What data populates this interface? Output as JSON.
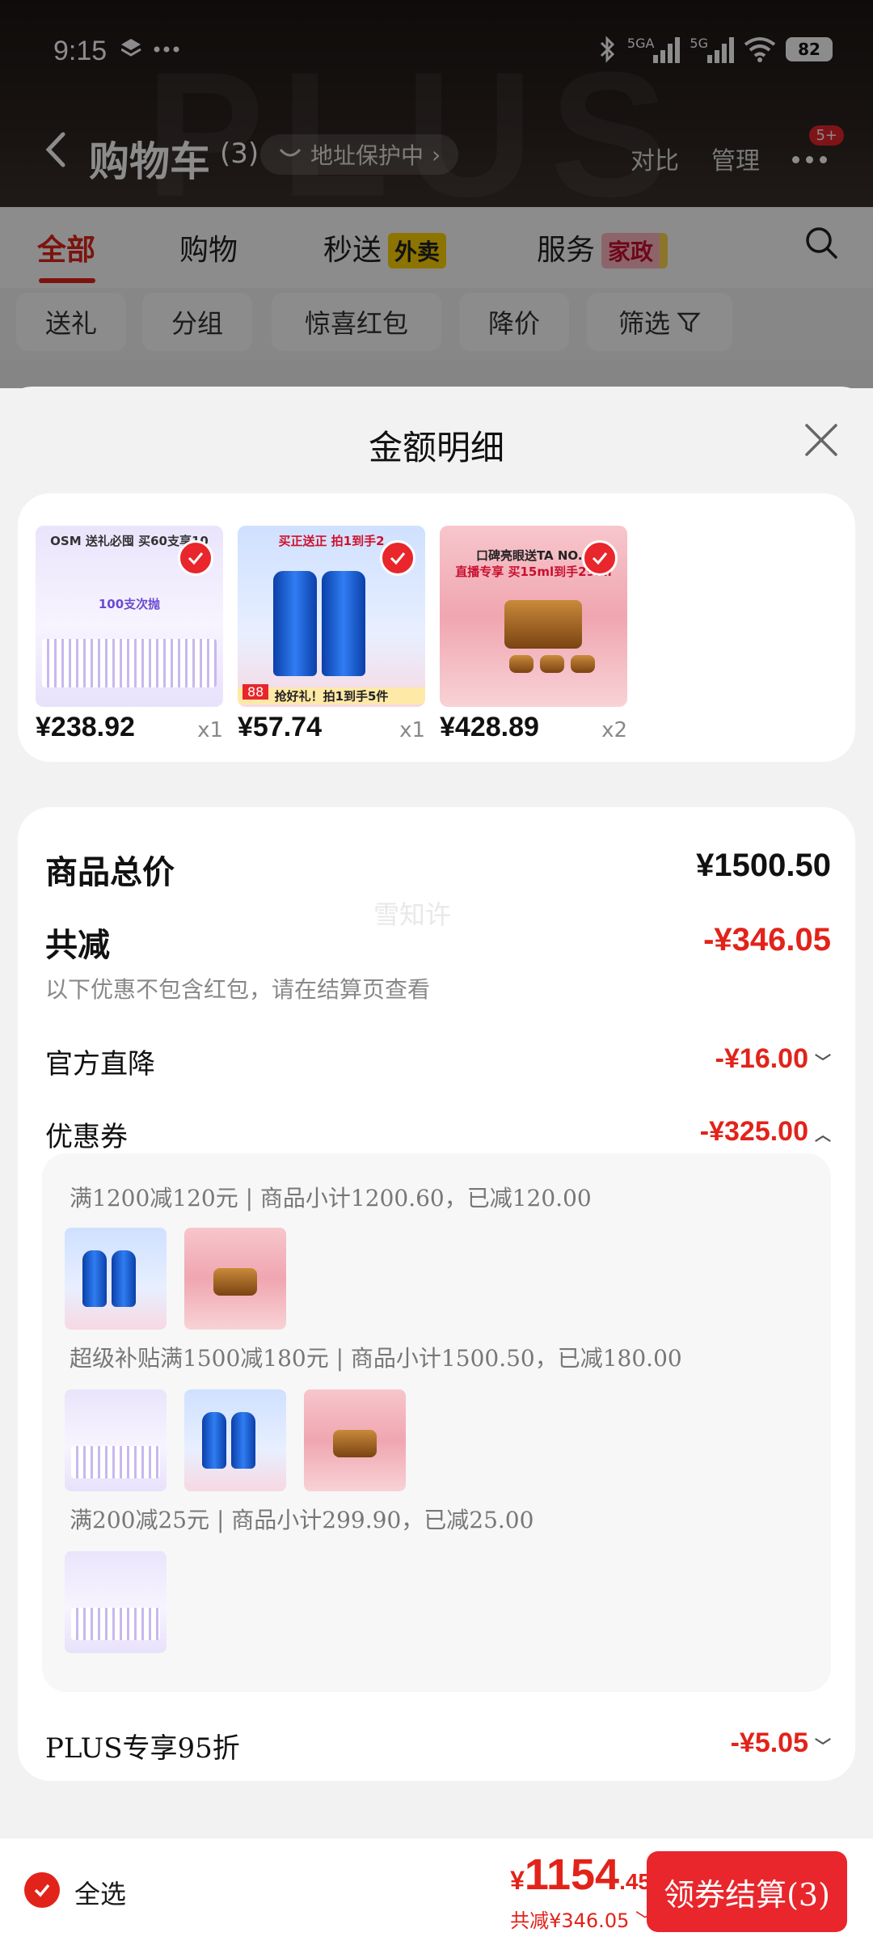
{
  "status_bar": {
    "time": "9:15",
    "battery": "82",
    "signal1_label": "5GA",
    "signal2_label": "5G"
  },
  "nav": {
    "title": "购物车",
    "count": "(3)",
    "address_pill": "地址保护中",
    "compare": "对比",
    "manage": "管理",
    "badge": "5+",
    "watermark": "PLUS"
  },
  "tabs": [
    {
      "label": "全部"
    },
    {
      "label": "购物"
    },
    {
      "label": "秒送",
      "tag": "外卖"
    },
    {
      "label": "服务",
      "tag": "家政"
    }
  ],
  "chips": [
    "送礼",
    "分组",
    "惊喜红包",
    "降价",
    "筛选"
  ],
  "sheet": {
    "title": "金额明细",
    "products": [
      {
        "price": "¥238.92",
        "qty": "x1",
        "img_text1": "OSM 送礼必囤 买60支享10",
        "img_text2": "100支次抛"
      },
      {
        "price": "¥57.74",
        "qty": "x1",
        "img_text1": "买正送正 拍1到手2",
        "img_text2": "抢好礼！拍1到手5件",
        "img_tag": "88"
      },
      {
        "price": "¥428.89",
        "qty": "x2",
        "img_text1": "口碑亮眼送TA NO.1",
        "img_text2": "直播专享 买15ml到手29ml"
      }
    ],
    "summary": {
      "goods_total_label": "商品总价",
      "goods_total_value": "¥1500.50",
      "total_discount_label": "共减",
      "total_discount_value": "-¥346.05",
      "note": "以下优惠不包含红包，请在结算页查看",
      "official_label": "官方直降",
      "official_value": "-¥16.00",
      "coupon_label": "优惠券",
      "coupon_value": "-¥325.00",
      "plus_label": "PLUS专享95折",
      "plus_value": "-¥5.05",
      "watermark": "雪知许"
    },
    "coupons": [
      {
        "text": "满1200减120元 | 商品小计1200.60，已减120.00"
      },
      {
        "text": "超级补贴满1500减180元 | 商品小计1500.50，已减180.00"
      },
      {
        "text": "满200减25元 | 商品小计299.90，已减25.00"
      }
    ]
  },
  "bottom": {
    "select_all": "全选",
    "total_currency": "¥",
    "total_int": "1154",
    "total_dec": ".45",
    "total_sub": "共减¥346.05",
    "checkout": "领券结算(3)"
  },
  "colors": {
    "accent": "#e2231a",
    "header_bg": "#1b1614"
  }
}
